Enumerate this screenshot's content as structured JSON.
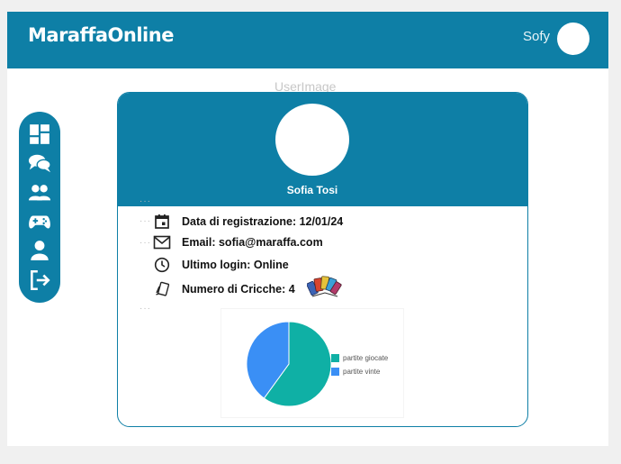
{
  "header": {
    "brand": "MaraffaOnline",
    "username": "Sofy"
  },
  "sidebar": {
    "items": [
      {
        "icon": "dashboard-icon"
      },
      {
        "icon": "chat-icon"
      },
      {
        "icon": "friends-icon"
      },
      {
        "icon": "gamepad-icon"
      },
      {
        "icon": "profile-icon"
      },
      {
        "icon": "logout-icon"
      }
    ]
  },
  "profile": {
    "image_alt": "UserImage",
    "name": "Sofia Tosi",
    "registration": "Data di registrazione: 12/01/24",
    "email": "Email: sofia@maraffa.com",
    "last_login": "Ultimo login: Online",
    "cricche": "Numero di Cricche: 4"
  },
  "colors": {
    "primary": "#0e7fa6",
    "pie_played": "#0fb0a5",
    "pie_won": "#3a8ff5"
  },
  "chart_data": {
    "type": "pie",
    "labels": [
      "partite giocate",
      "partite vinte"
    ],
    "values": [
      60,
      40
    ],
    "legend": "right"
  }
}
